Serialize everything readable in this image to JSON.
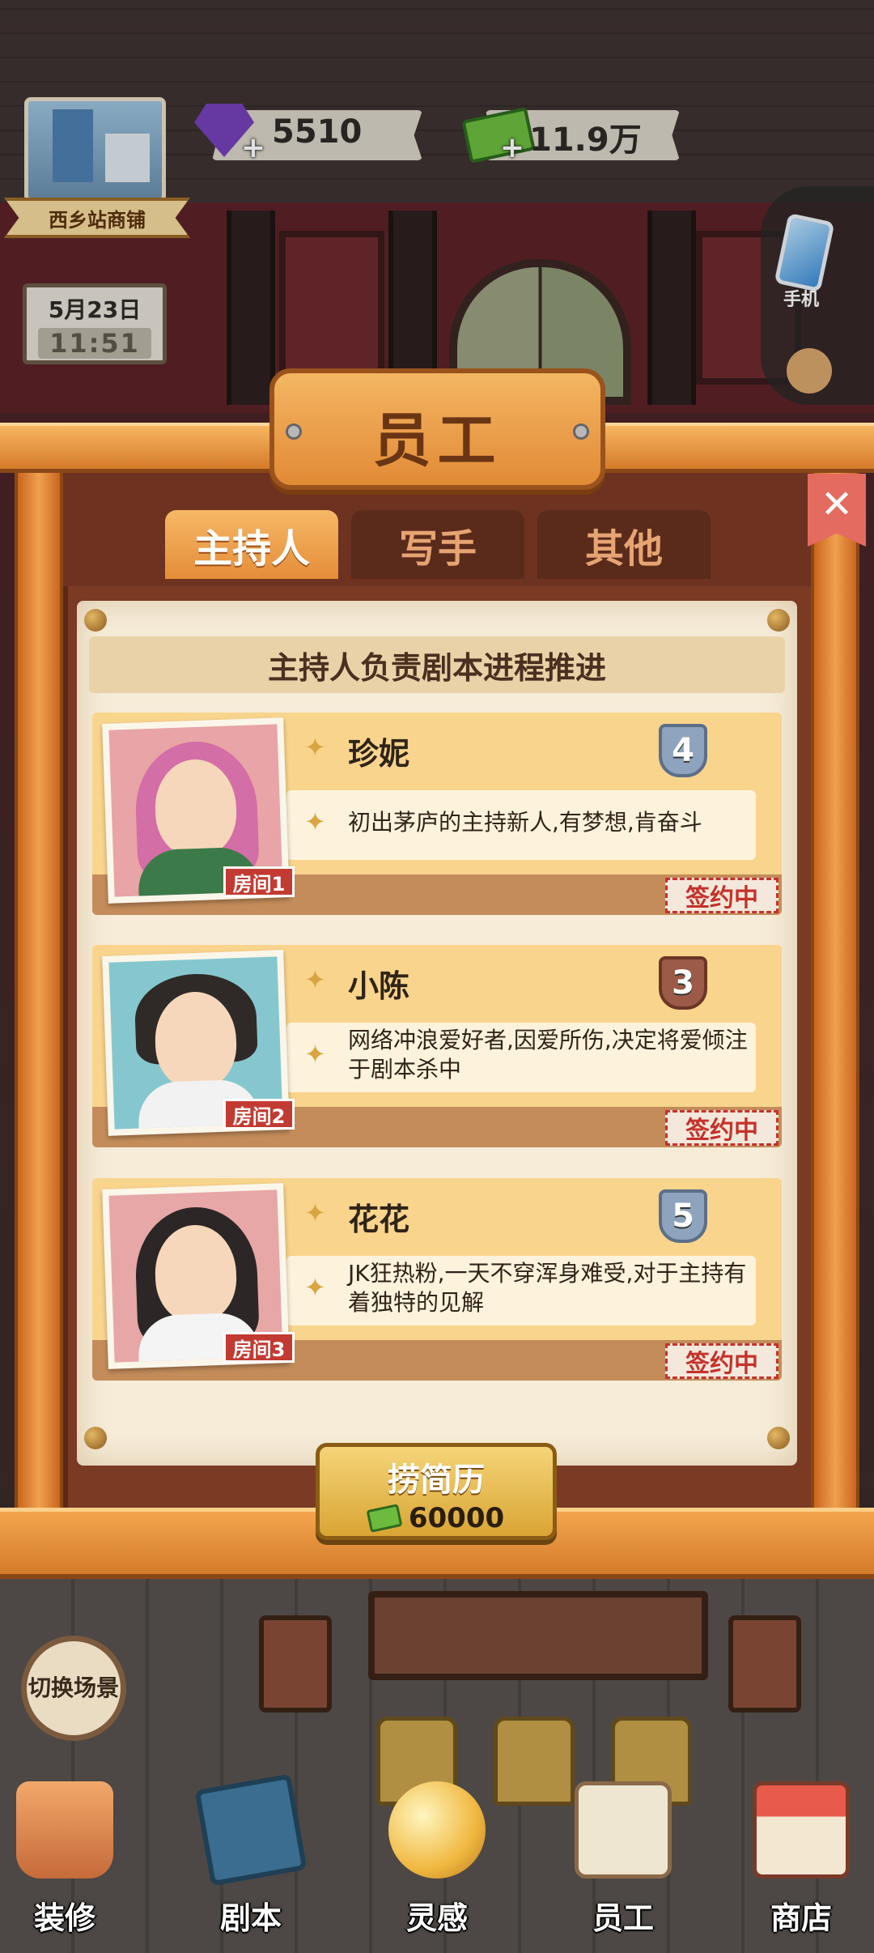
{
  "hud": {
    "store_name": "西乡站商铺",
    "date": "5月23日",
    "time": "11:51",
    "gems": "5510",
    "cash": "11.9万",
    "plus_symbol": "+",
    "phone_label": "手机"
  },
  "modal": {
    "title": "员工",
    "close_symbol": "✕",
    "tabs": [
      {
        "label": "主持人",
        "active": true
      },
      {
        "label": "写手",
        "active": false
      },
      {
        "label": "其他",
        "active": false
      }
    ],
    "subtitle": "主持人负责剧本进程推进",
    "employees": [
      {
        "name": "珍妮",
        "desc": "初出茅庐的主持新人,有梦想,肯奋斗",
        "level": "4",
        "room": "房间1",
        "status": "签约中"
      },
      {
        "name": "小陈",
        "desc": "网络冲浪爱好者,因爱所伤,决定将爱倾注于剧本杀中",
        "level": "3",
        "room": "房间2",
        "status": "签约中"
      },
      {
        "name": "花花",
        "desc": "JK狂热粉,一天不穿浑身难受,对于主持有着独特的见解",
        "level": "5",
        "room": "房间3",
        "status": "签约中"
      }
    ],
    "hire_button": {
      "label": "捞简历",
      "cost": "60000"
    }
  },
  "switch_scene": "切换场景",
  "nav": [
    {
      "label": "装修",
      "icon": "house-icon"
    },
    {
      "label": "剧本",
      "icon": "script-book-icon"
    },
    {
      "label": "灵感",
      "icon": "crystal-ball-icon"
    },
    {
      "label": "员工",
      "icon": "staff-badge-icon"
    },
    {
      "label": "商店",
      "icon": "shop-icon"
    }
  ],
  "colors": {
    "accent_orange": "#e58d38",
    "signed_red": "#c4322a",
    "close_red": "#e46b60"
  }
}
